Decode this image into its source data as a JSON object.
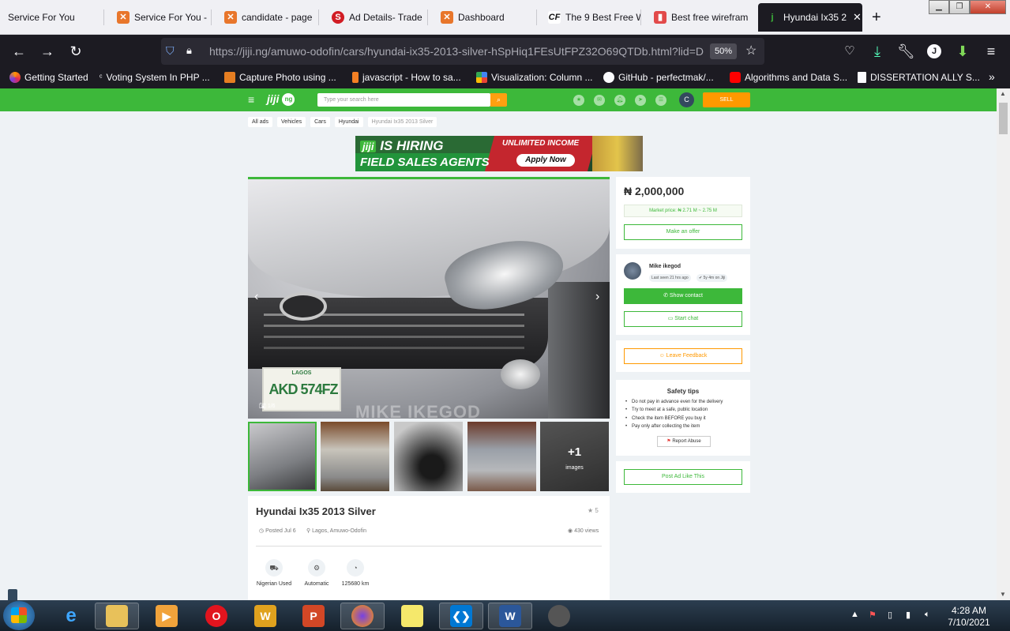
{
  "browser": {
    "tabs": [
      {
        "label": "Service For You",
        "color": "#f0f0f4"
      },
      {
        "label": "Service For You - ",
        "color": "#e8762b"
      },
      {
        "label": "candidate - page",
        "color": "#e8762b"
      },
      {
        "label": "Ad Details- Trade",
        "color": "#d11c24"
      },
      {
        "label": "Dashboard",
        "color": "#e8762b"
      },
      {
        "label": "The 9 Best Free W",
        "color": "#111111"
      },
      {
        "label": "Best free wirefram",
        "color": "#e24a4a"
      },
      {
        "label": "Hyundai Ix35 20",
        "color": "#3db83a"
      }
    ],
    "new_tab": "+",
    "url": "https://jiji.ng/amuwo-odofin/cars/hyundai-ix35-2013-silver-hSpHiq1FEsUtFPZ32O69QTDb.html?lid=D",
    "zoom": "50%",
    "bookmarks": [
      "Getting Started",
      "Voting System In PHP ...",
      "Capture Photo using ...",
      "javascript - How to sa...",
      "Visualization: Column ...",
      "GitHub - perfectmak/...",
      "Algorithms and Data S...",
      "DISSERTATION ALLY S..."
    ],
    "profile_initial": "J"
  },
  "header": {
    "logo": "jiji",
    "logo_suffix": "ng",
    "search_placeholder": "Type your search here",
    "avatar_initial": "C",
    "sell_label": "SELL"
  },
  "breadcrumbs": [
    "All ads",
    "Vehicles",
    "Cars",
    "Hyundai",
    "Hyundai Ix35 2013 Silver"
  ],
  "banner": {
    "line1": "IS HIRING",
    "line2": "FIELD SALES AGENTS",
    "income": "UNLIMITED INCOME",
    "apply": "Apply Now",
    "logo": "jiji"
  },
  "gallery": {
    "counter": "1/6",
    "watermark": "MIKE IKEGOD",
    "plate": "AKD 574FZ",
    "plate_state": "LAGOS",
    "more_count": "+1",
    "more_label": "images"
  },
  "listing": {
    "title": "Hyundai Ix35 2013 Silver",
    "stars": "5",
    "posted": "Posted Jul 6",
    "location": "Lagos, Amuwo-Odofin",
    "views": "430 views",
    "attributes": [
      {
        "label": "Nigerian Used",
        "icon": "car-icon"
      },
      {
        "label": "Automatic",
        "icon": "gearbox-icon"
      },
      {
        "label": "125680 km",
        "icon": "speedometer-icon"
      }
    ]
  },
  "sidebar": {
    "price": "₦ 2,000,000",
    "market_price": "Market price: ₦ 2.71 M ~ 2.75 M",
    "make_offer": "Make an offer",
    "seller_name": "Mike ikegod",
    "last_seen": "Last seen 21 hrs ago",
    "on_jiji": "5y 4m on Jiji",
    "show_contact": "Show contact",
    "start_chat": "Start chat",
    "leave_feedback": "Leave Feedback",
    "safety_title": "Safety tips",
    "tips": [
      "Do not pay in advance even for the delivery",
      "Try to meet at a safe, public location",
      "Check the item BEFORE you buy it",
      "Pay only after collecting the item"
    ],
    "report_abuse": "Report Abuse",
    "post_ad_like": "Post Ad Like This"
  },
  "taskbar": {
    "time": "4:28 AM",
    "date": "7/10/2021"
  },
  "colors": {
    "jiji_green": "#3db83a",
    "sell_orange": "#ff9900",
    "browser_dark": "#1c1b22"
  }
}
